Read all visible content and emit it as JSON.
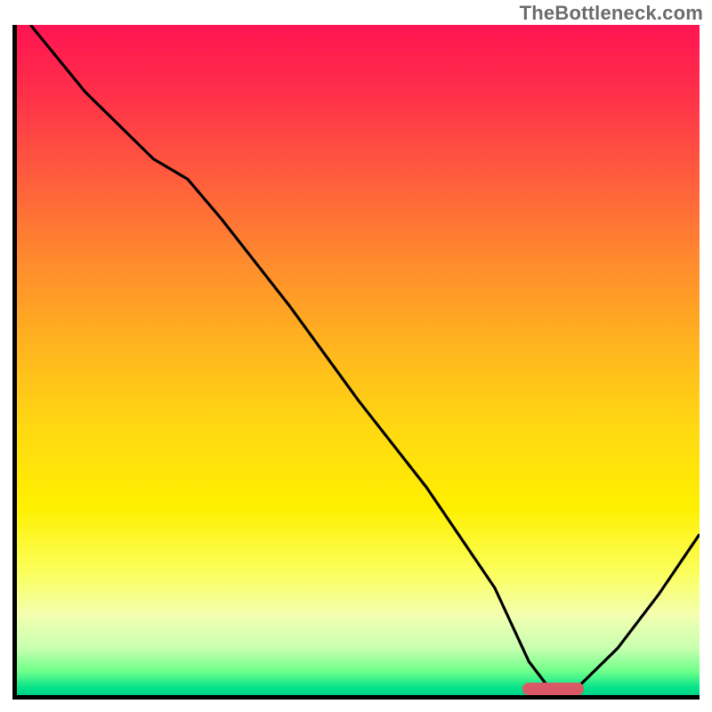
{
  "watermark": "TheBottleneck.com",
  "colors": {
    "gradient_top": "#ff1452",
    "gradient_mid": "#ffe000",
    "gradient_bottom": "#00cf86",
    "axis": "#000000",
    "curve": "#000000",
    "marker": "#d95a66",
    "watermark_text": "#6b6b6b"
  },
  "chart_data": {
    "type": "line",
    "title": "",
    "xlabel": "",
    "ylabel": "",
    "xlim": [
      0,
      100
    ],
    "ylim": [
      0,
      100
    ],
    "grid": false,
    "legend": false,
    "note": "Axes are unlabeled in the source image. x/y values are read as percentages of the plot area (origin at bottom-left). The curve descends from top-left, flattens near the bottom around x≈75–82, then rises toward the right edge.",
    "series": [
      {
        "name": "bottleneck-curve",
        "x": [
          2,
          10,
          20,
          25,
          30,
          40,
          50,
          60,
          70,
          75,
          78,
          82,
          88,
          94,
          100
        ],
        "y": [
          100,
          90,
          80,
          77,
          71,
          58,
          44,
          31,
          16,
          5,
          1,
          1,
          7,
          15,
          24
        ]
      }
    ],
    "marker": {
      "description": "highlighted optimal range on x-axis",
      "x_start": 74,
      "x_end": 83,
      "y": 0.5,
      "color": "#d95a66"
    }
  }
}
